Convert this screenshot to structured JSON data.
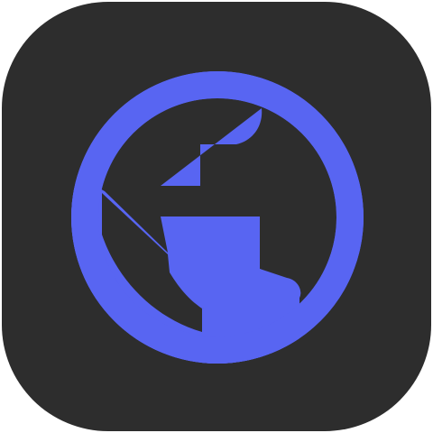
{
  "app_icon": {
    "icon": "globe-icon",
    "background_color": "#2d2d2d",
    "glyph_color": "#5865f2"
  }
}
